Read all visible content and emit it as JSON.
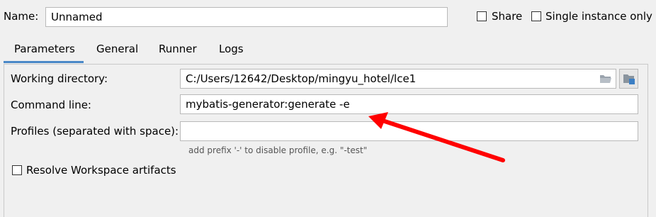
{
  "header": {
    "name_label": "Name:",
    "name_value": "Unnamed",
    "share_label": "Share",
    "single_instance_label": "Single instance only",
    "share_checked": false,
    "single_instance_checked": false
  },
  "tabs": [
    {
      "label": "Parameters",
      "active": true
    },
    {
      "label": "General",
      "active": false
    },
    {
      "label": "Runner",
      "active": false
    },
    {
      "label": "Logs",
      "active": false
    }
  ],
  "parameters": {
    "working_directory_label": "Working directory:",
    "working_directory_value": "C:/Users/12642/Desktop/mingyu_hotel/lce1",
    "command_line_label": "Command line:",
    "command_line_value": "mybatis-generator:generate -e",
    "profiles_label": "Profiles (separated with space):",
    "profiles_value": "",
    "profiles_hint": "add prefix '-' to disable profile, e.g. \"-test\"",
    "resolve_workspace_label": "Resolve Workspace artifacts",
    "resolve_workspace_checked": false
  },
  "icons": [
    "folder-icon",
    "module-icon"
  ],
  "colors": {
    "accent": "#4a88c7",
    "arrow": "#ff0000"
  }
}
